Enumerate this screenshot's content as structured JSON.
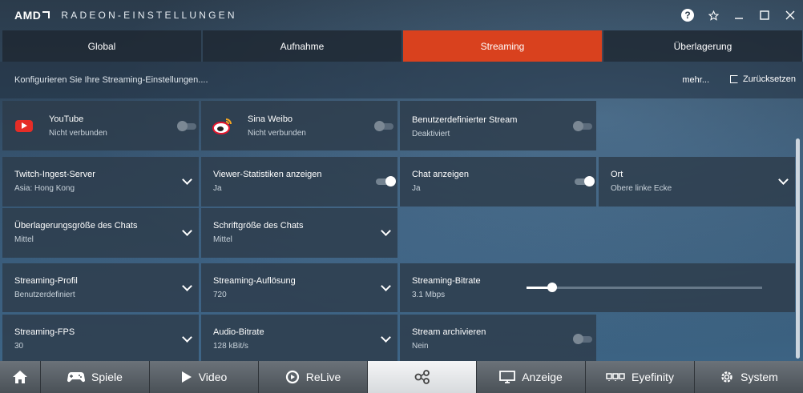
{
  "titlebar": {
    "brand": "AMD",
    "title": "RADEON-EINSTELLUNGEN",
    "icons": [
      "help-icon",
      "star-icon",
      "minimize-icon",
      "maximize-icon",
      "close-icon"
    ]
  },
  "tabs": [
    {
      "label": "Global",
      "active": false
    },
    {
      "label": "Aufnahme",
      "active": false
    },
    {
      "label": "Streaming",
      "active": true
    },
    {
      "label": "Überlagerung",
      "active": false
    }
  ],
  "subbar": {
    "description": "Konfigurieren Sie Ihre Streaming-Einstellungen....",
    "more": "mehr...",
    "reset": "Zurücksetzen"
  },
  "services": [
    {
      "name": "YouTube",
      "status": "Nicht verbunden",
      "enabled": false
    },
    {
      "name": "Sina Weibo",
      "status": "Nicht verbunden",
      "enabled": false
    },
    {
      "name": "Benutzerdefinierter Stream",
      "status": "Deaktiviert",
      "enabled": false
    }
  ],
  "overlay_settings": {
    "twitch": {
      "label": "Twitch-Ingest-Server",
      "value": "Asia: Hong Kong"
    },
    "viewer_stats": {
      "label": "Viewer-Statistiken anzeigen",
      "value": "Ja",
      "enabled": true
    },
    "chat": {
      "label": "Chat anzeigen",
      "value": "Ja",
      "enabled": true
    },
    "position": {
      "label": "Ort",
      "value": "Obere linke Ecke"
    },
    "chat_overlay_size": {
      "label": "Überlagerungsgröße des Chats",
      "value": "Mittel"
    },
    "chat_font_size": {
      "label": "Schriftgröße des Chats",
      "value": "Mittel"
    }
  },
  "stream_settings": {
    "profile": {
      "label": "Streaming-Profil",
      "value": "Benutzerdefiniert"
    },
    "resolution": {
      "label": "Streaming-Auflösung",
      "value": "720"
    },
    "bitrate": {
      "label": "Streaming-Bitrate",
      "value": "3.1 Mbps",
      "slider_fraction": 0.11
    },
    "fps": {
      "label": "Streaming-FPS",
      "value": "30"
    },
    "audio_bitrate": {
      "label": "Audio-Bitrate",
      "value": "128 kBit/s"
    },
    "archive": {
      "label": "Stream archivieren",
      "value": "Nein",
      "enabled": false
    }
  },
  "bottom_nav": [
    {
      "label": "",
      "icon": "home-icon"
    },
    {
      "label": "Spiele",
      "icon": "gamepad-icon"
    },
    {
      "label": "Video",
      "icon": "play-icon"
    },
    {
      "label": "ReLive",
      "icon": "relive-icon"
    },
    {
      "label": "",
      "icon": "share-icon",
      "active": true
    },
    {
      "label": "Anzeige",
      "icon": "monitor-icon"
    },
    {
      "label": "Eyefinity",
      "icon": "eyefinity-icon"
    },
    {
      "label": "System",
      "icon": "gear-icon"
    }
  ],
  "colors": {
    "accent": "#d9411e",
    "tile": "#2d3c4b",
    "nav": "#5a6168"
  }
}
